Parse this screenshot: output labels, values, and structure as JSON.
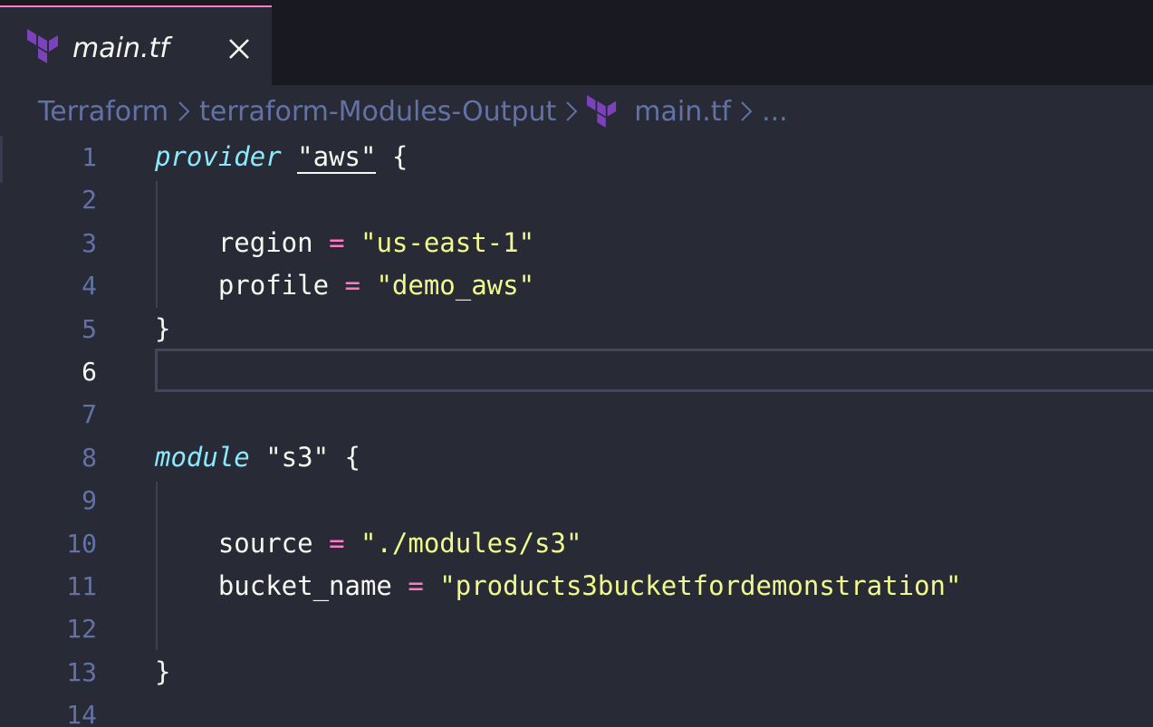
{
  "colors": {
    "background": "#282a36",
    "tabbar_background": "#191a21",
    "tab_active_border": "#ff79c6",
    "terraform_purple": "#7b42bc",
    "keyword": "#8be9fd",
    "string": "#f1fa8c",
    "operator": "#ff79c6",
    "line_number": "#6272a4",
    "foreground": "#f8f8f2"
  },
  "tab": {
    "icon": "terraform-icon",
    "label": "main.tf",
    "close_icon": "close-icon"
  },
  "breadcrumb": {
    "items": [
      "Terraform",
      "terraform-Modules-Output",
      "main.tf",
      "..."
    ],
    "file_icon": "terraform-icon",
    "separator_icon": "chevron-right-icon"
  },
  "editor": {
    "active_line": 6,
    "lines": [
      {
        "number": "1",
        "tokens": [
          {
            "t": "provider",
            "k": "kw"
          },
          {
            "t": " ",
            "k": "plain"
          },
          {
            "t": "\"aws\"",
            "k": "str-underlined"
          },
          {
            "t": " {",
            "k": "plain"
          }
        ]
      },
      {
        "number": "2",
        "tokens": []
      },
      {
        "number": "3",
        "tokens": [
          {
            "t": "    region ",
            "k": "plain"
          },
          {
            "t": "=",
            "k": "op"
          },
          {
            "t": " ",
            "k": "plain"
          },
          {
            "t": "\"us-east-1\"",
            "k": "str"
          }
        ]
      },
      {
        "number": "4",
        "tokens": [
          {
            "t": "    profile ",
            "k": "plain"
          },
          {
            "t": "=",
            "k": "op"
          },
          {
            "t": " ",
            "k": "plain"
          },
          {
            "t": "\"demo_aws\"",
            "k": "str"
          }
        ]
      },
      {
        "number": "5",
        "tokens": [
          {
            "t": "}",
            "k": "plain"
          }
        ]
      },
      {
        "number": "6",
        "tokens": []
      },
      {
        "number": "7",
        "tokens": []
      },
      {
        "number": "8",
        "tokens": [
          {
            "t": "module",
            "k": "kw"
          },
          {
            "t": " \"s3\" {",
            "k": "plain"
          }
        ]
      },
      {
        "number": "9",
        "tokens": []
      },
      {
        "number": "10",
        "tokens": [
          {
            "t": "    source ",
            "k": "plain"
          },
          {
            "t": "=",
            "k": "op"
          },
          {
            "t": " ",
            "k": "plain"
          },
          {
            "t": "\"./modules/s3\"",
            "k": "str"
          }
        ]
      },
      {
        "number": "11",
        "tokens": [
          {
            "t": "    bucket_name ",
            "k": "plain"
          },
          {
            "t": "=",
            "k": "op"
          },
          {
            "t": " ",
            "k": "plain"
          },
          {
            "t": "\"products3bucketfordemonstration\"",
            "k": "str"
          }
        ]
      },
      {
        "number": "12",
        "tokens": []
      },
      {
        "number": "13",
        "tokens": [
          {
            "t": "}",
            "k": "plain"
          }
        ]
      },
      {
        "number": "14",
        "tokens": []
      }
    ]
  }
}
